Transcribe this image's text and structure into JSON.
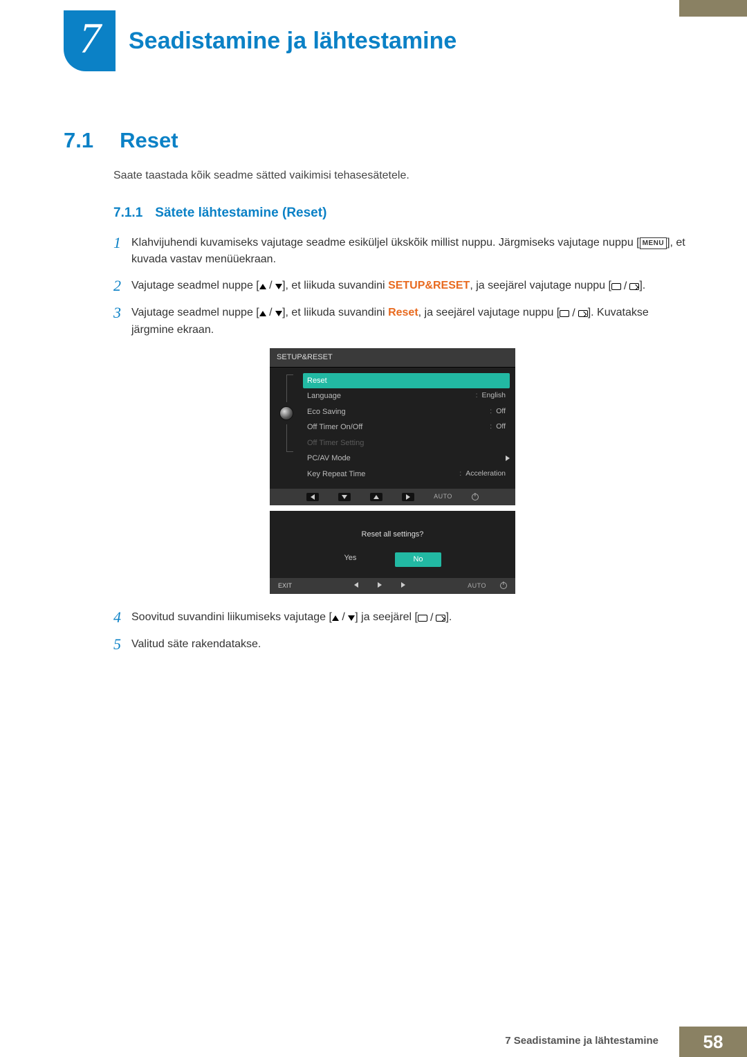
{
  "chapter": {
    "number": "7",
    "title": "Seadistamine ja lähtestamine"
  },
  "section": {
    "number": "7.1",
    "title": "Reset",
    "intro": "Saate taastada kõik seadme sätted vaikimisi tehasesätetele."
  },
  "subsection": {
    "number": "7.1.1",
    "title": "Sätete lähtestamine (Reset)"
  },
  "steps": {
    "s1a": "Klahvijuhendi kuvamiseks vajutage seadme esiküljel ükskõik millist nuppu. Järgmiseks vajutage nuppu [",
    "s1_menu": "MENU",
    "s1b": "], et kuvada vastav menüüekraan.",
    "s2a": "Vajutage seadmel nuppe [",
    "s2b": "], et liikuda suvandini ",
    "s2_hl": "SETUP&RESET",
    "s2c": ", ja seejärel vajutage nuppu [",
    "s2d": "].",
    "s3a": "Vajutage seadmel nuppe [",
    "s3b": "], et liikuda suvandini ",
    "s3_hl": "Reset",
    "s3c": ", ja seejärel vajutage nuppu [",
    "s3d": "]. Kuvatakse järgmine ekraan.",
    "s4a": "Soovitud suvandini liikumiseks vajutage [",
    "s4b": "] ja seejärel [",
    "s4c": "].",
    "s5": "Valitud säte rakendatakse."
  },
  "osd": {
    "header": "SETUP&RESET",
    "rows": {
      "reset": "Reset",
      "language": "Language",
      "language_val": "English",
      "eco": "Eco Saving",
      "eco_val": "Off",
      "offtimer": "Off Timer On/Off",
      "offtimer_val": "Off",
      "offtimer_setting": "Off Timer Setting",
      "pcav": "PC/AV Mode",
      "keyrepeat": "Key Repeat Time",
      "keyrepeat_val": "Acceleration"
    },
    "nav_auto": "AUTO"
  },
  "dialog": {
    "question": "Reset all settings?",
    "yes": "Yes",
    "no": "No",
    "exit": "EXIT",
    "auto": "AUTO"
  },
  "footer": {
    "text": "7 Seadistamine ja lähtestamine",
    "page": "58"
  }
}
